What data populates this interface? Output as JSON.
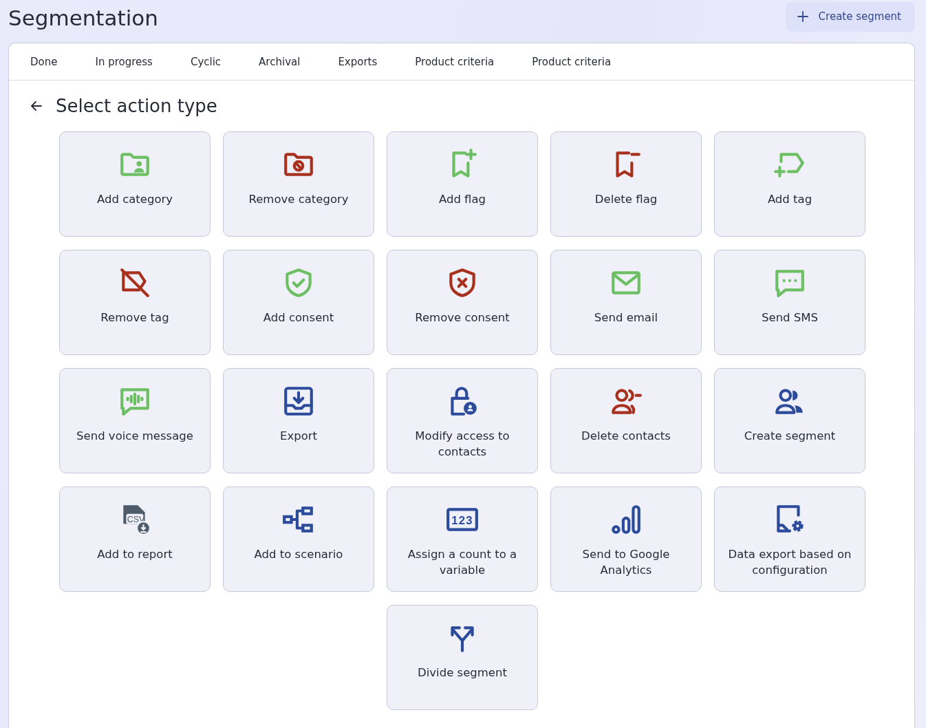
{
  "title": "Segmentation",
  "create_button": {
    "label": "Create segment"
  },
  "tabs": [
    {
      "label": "Done",
      "selected": false
    },
    {
      "label": "In progress",
      "selected": false
    },
    {
      "label": "Cyclic",
      "selected": false
    },
    {
      "label": "Archival",
      "selected": false
    },
    {
      "label": "Exports",
      "selected": false
    },
    {
      "label": "Product criteria",
      "selected": false
    },
    {
      "label": "Product criteria",
      "selected": false
    }
  ],
  "heading": "Select action type",
  "cards": [
    {
      "label": "Add category",
      "kind": "folder-person",
      "color": "#6cbf63"
    },
    {
      "label": "Remove category",
      "kind": "folder-ban",
      "color": "#a8311e"
    },
    {
      "label": "Add flag",
      "kind": "bookmark-plus",
      "color": "#6cbf63"
    },
    {
      "label": "Delete flag",
      "kind": "bookmark-minus",
      "color": "#a8311e"
    },
    {
      "label": "Add tag",
      "kind": "tag-plus",
      "color": "#6cbf63"
    },
    {
      "label": "Remove tag",
      "kind": "tag-off",
      "color": "#a8311e"
    },
    {
      "label": "Add consent",
      "kind": "shield-check",
      "color": "#6cbf63"
    },
    {
      "label": "Remove consent",
      "kind": "shield-x",
      "color": "#a8311e"
    },
    {
      "label": "Send email",
      "kind": "mail",
      "color": "#6cbf63"
    },
    {
      "label": "Send SMS",
      "kind": "chat",
      "color": "#6cbf63"
    },
    {
      "label": "Send voice message",
      "kind": "voice",
      "color": "#6cbf63"
    },
    {
      "label": "Export",
      "kind": "download-tray",
      "color": "#2c4b9b"
    },
    {
      "label": "Modify access to contacts",
      "kind": "lock-person",
      "color": "#2c4b9b"
    },
    {
      "label": "Delete contacts",
      "kind": "users-minus",
      "color": "#a8311e"
    },
    {
      "label": "Create segment",
      "kind": "users",
      "color": "#2c4b9b"
    },
    {
      "label": "Add to report",
      "kind": "csv-file",
      "color": "#4d5b6b",
      "icon_text": "CSV"
    },
    {
      "label": "Add to scenario",
      "kind": "tree",
      "color": "#2c4b9b"
    },
    {
      "label": "Assign a count to a variable",
      "kind": "number-box",
      "color": "#2c4b9b",
      "icon_text": "123"
    },
    {
      "label": "Send to Google Analytics",
      "kind": "bar-chart",
      "color": "#2c4b9b"
    },
    {
      "label": "Data export based on configuration",
      "kind": "screen-gear",
      "color": "#2c4b9b"
    },
    {
      "label": "Divide segment",
      "kind": "split",
      "color": "#2c4b9b"
    }
  ]
}
